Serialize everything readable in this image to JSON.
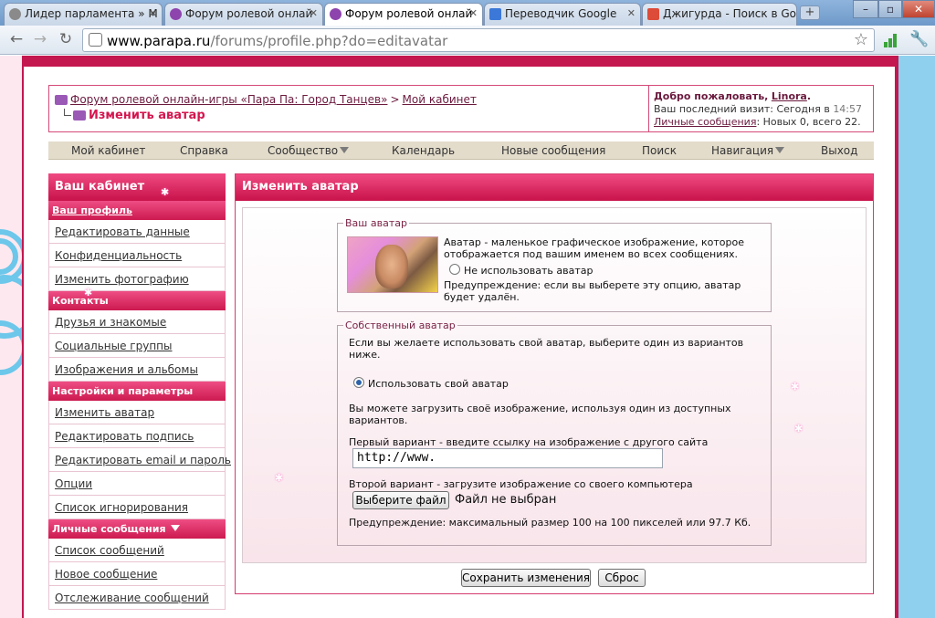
{
  "tabs": [
    {
      "title": "Лидер парламента » М",
      "active": false
    },
    {
      "title": "Форум ролевой онлай",
      "active": false
    },
    {
      "title": "Форум ролевой онлай",
      "active": true
    },
    {
      "title": "Переводчик Google",
      "active": false
    },
    {
      "title": "Джигурда - Поиск в Go",
      "active": false
    }
  ],
  "tab_close": "✕",
  "newtab_label": "+",
  "window_controls": {
    "minimize": "–",
    "maximize": "▫",
    "close": "✕"
  },
  "toolbar": {
    "back": "←",
    "forward": "→",
    "reload": "↻",
    "url_host": "www.parapa.ru",
    "url_path": "/forums/profile.php?do=editavatar",
    "star": "☆",
    "wrench": "🔧"
  },
  "breadcrumb": {
    "forum_link": "Форум ролевой онлайн-игры «Пара Па: Город Танцев»",
    "separator": ">",
    "cabinet_link": "Мой кабинет",
    "current": "Изменить аватар"
  },
  "welcome": {
    "greeting": "Добро пожаловать,",
    "username": "Linora",
    "greeting_end": ".",
    "last_visit_label": "Ваш последний визит: Сегодня в",
    "last_visit_time": "14:57",
    "pm_link": "Личные сообщения",
    "pm_text": ": Новых 0, всего 22."
  },
  "navbar": {
    "items": [
      "Мой кабинет",
      "Справка",
      "Сообщество",
      "Календарь",
      "Новые сообщения",
      "Поиск",
      "Навигация",
      "Выход"
    ]
  },
  "sidebar": {
    "title": "Ваш кабинет",
    "sections": [
      {
        "title": "Ваш профиль",
        "items": [
          "Редактировать данные",
          "Конфиденциальность",
          "Изменить фотографию"
        ]
      },
      {
        "title": "Контакты",
        "items": [
          "Друзья и знакомые",
          "Социальные группы",
          "Изображения и альбомы"
        ]
      },
      {
        "title": "Настройки и параметры",
        "items": [
          "Изменить аватар",
          "Редактировать подпись",
          "Редактировать email и пароль",
          "Опции",
          "Список игнорирования"
        ]
      },
      {
        "title": "Личные сообщения",
        "items": [
          "Список сообщений",
          "Новое сообщение",
          "Отслеживание сообщений"
        ]
      }
    ]
  },
  "main": {
    "title": "Изменить аватар",
    "your_avatar": {
      "legend": "Ваш аватар",
      "desc_line1": "Аватар - маленькое графическое изображение, которое",
      "desc_line2": "отображается под вашим именем во всех сообщениях.",
      "no_avatar_label": "Не использовать аватар",
      "warning_line1": "Предупреждение: если вы выберете эту опцию, аватар",
      "warning_line2": "будет удалён."
    },
    "custom_avatar": {
      "legend": "Собственный аватар",
      "intro_line1": "Если вы желаете использовать свой аватар, выберите один из вариантов",
      "intro_line2": "ниже.",
      "use_own_label": "Использовать свой аватар",
      "upload_line1": "Вы можете загрузить своё изображение, используя один из доступных",
      "upload_line2": "вариантов.",
      "option1_label": "Первый вариант - введите ссылку на изображение с другого сайта",
      "url_value": "http://www.",
      "option2_label": "Второй вариант - загрузите изображение со своего компьютера",
      "choose_file_button": "Выберите файл",
      "file_status": "Файл не выбран",
      "size_warning": "Предупреждение: максимальный размер 100 на 100 пикселей или 97.7 Кб."
    },
    "save_button": "Сохранить изменения",
    "reset_button": "Сброс"
  }
}
